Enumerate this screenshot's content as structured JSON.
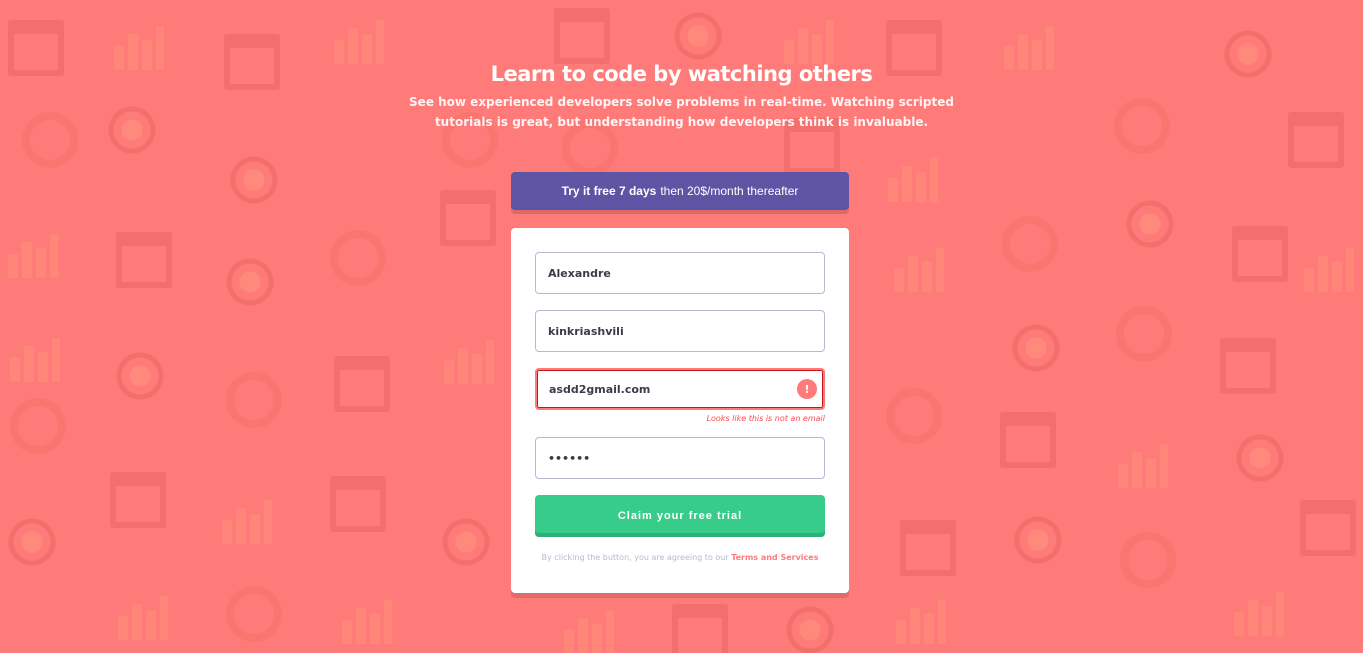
{
  "hero": {
    "title": "Learn to code by watching others",
    "subtitle": "See how experienced developers solve problems in real-time. Watching scripted tutorials is great, but understanding how developers think is invaluable."
  },
  "promo": {
    "bold": "Try it free 7 days",
    "rest": "then 20$/month thereafter"
  },
  "form": {
    "first_name": {
      "value": "Alexandre"
    },
    "last_name": {
      "value": "kinkriashvili"
    },
    "email": {
      "value": "asdd2gmail.com",
      "error": "Looks like this is not an email",
      "error_icon": "!"
    },
    "password": {
      "value": "••••••"
    },
    "submit_label": "Claim your free trial",
    "terms_prefix": "By clicking the button, you are agreeing to our ",
    "terms_link": "Terms and Services"
  },
  "colors": {
    "background": "#ff7b79",
    "promo": "#5e54a4",
    "submit": "#38cc8b",
    "error": "#ff7a7a"
  }
}
